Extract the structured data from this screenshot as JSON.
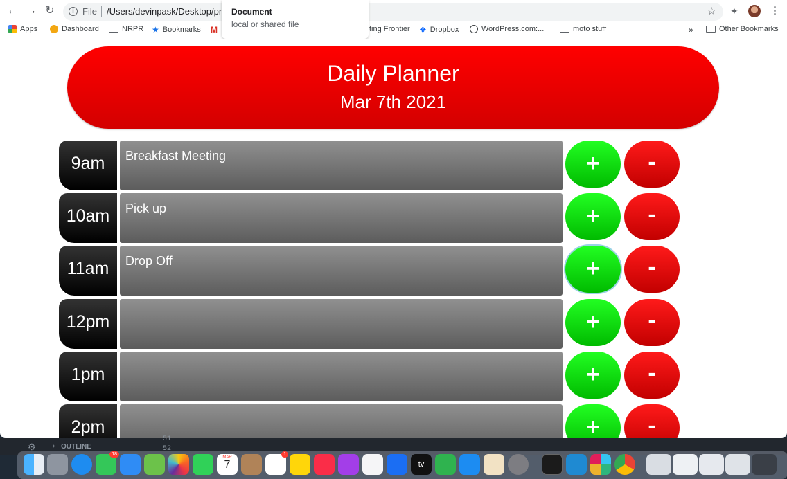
{
  "browser": {
    "url_scheme": "File",
    "url_path": "/Users/devinpask/Desktop/pro",
    "tooltip_title": "Document",
    "tooltip_subtitle": "local or shared file",
    "bookmarks": [
      "Apps",
      "Dashboard",
      "NRPR",
      "Bookmarks",
      "ting Frontier",
      "Dropbox",
      "WordPress.com:...",
      "moto stuff",
      "Other Bookmarks"
    ],
    "bookmarks_overflow": "»"
  },
  "planner": {
    "title": "Daily Planner",
    "date": "Mar 7th 2021",
    "add_label": "+",
    "remove_label": "-",
    "rows": [
      {
        "hour": "9am",
        "task": "Breakfast Meeting"
      },
      {
        "hour": "10am",
        "task": "Pick up"
      },
      {
        "hour": "11am",
        "task": "Drop Off"
      },
      {
        "hour": "12pm",
        "task": ""
      },
      {
        "hour": "1pm",
        "task": ""
      },
      {
        "hour": "2pm",
        "task": ""
      }
    ]
  },
  "editor": {
    "outline_label": "OUTLINE",
    "line_numbers": [
      "51",
      "52"
    ]
  },
  "dock": {
    "calendar_month": "MAR",
    "calendar_day": "7",
    "messages_badge": "18",
    "reminders_badge": "1",
    "appletv_label": "tv"
  },
  "colors": {
    "header": "#ff0000",
    "add_button": "#1fff1f",
    "remove_button": "#e60000",
    "hour_block": "#111111",
    "task_field": "#7a7a7a"
  }
}
